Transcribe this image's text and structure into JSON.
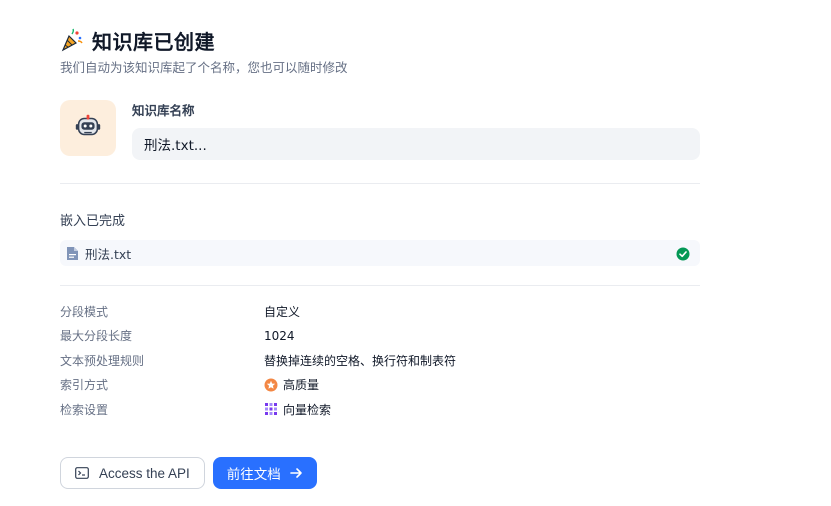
{
  "header": {
    "title": "知识库已创建",
    "subtitle": "我们自动为该知识库起了个名称，您也可以随时修改",
    "icon": "party-popper-icon"
  },
  "name_block": {
    "label": "知识库名称",
    "value": "刑法.txt...",
    "avatar_icon": "robot-icon"
  },
  "embedding": {
    "title": "嵌入已完成",
    "file_name": "刑法.txt",
    "file_icon": "document-icon",
    "status_icon": "check-circle-icon",
    "status_color": "#039855"
  },
  "info": {
    "rows": [
      {
        "label": "分段模式",
        "value": "自定义"
      },
      {
        "label": "最大分段长度",
        "value": "1024"
      },
      {
        "label": "文本预处理规则",
        "value": "替换掉连续的空格、换行符和制表符"
      },
      {
        "label": "索引方式",
        "value": "高质量",
        "icon": "star-badge-icon"
      },
      {
        "label": "检索设置",
        "value": "向量检索",
        "icon": "vector-grid-icon"
      }
    ]
  },
  "actions": {
    "api_label": "Access the API",
    "primary_label": "前往文档",
    "primary_color": "#2970ff"
  }
}
